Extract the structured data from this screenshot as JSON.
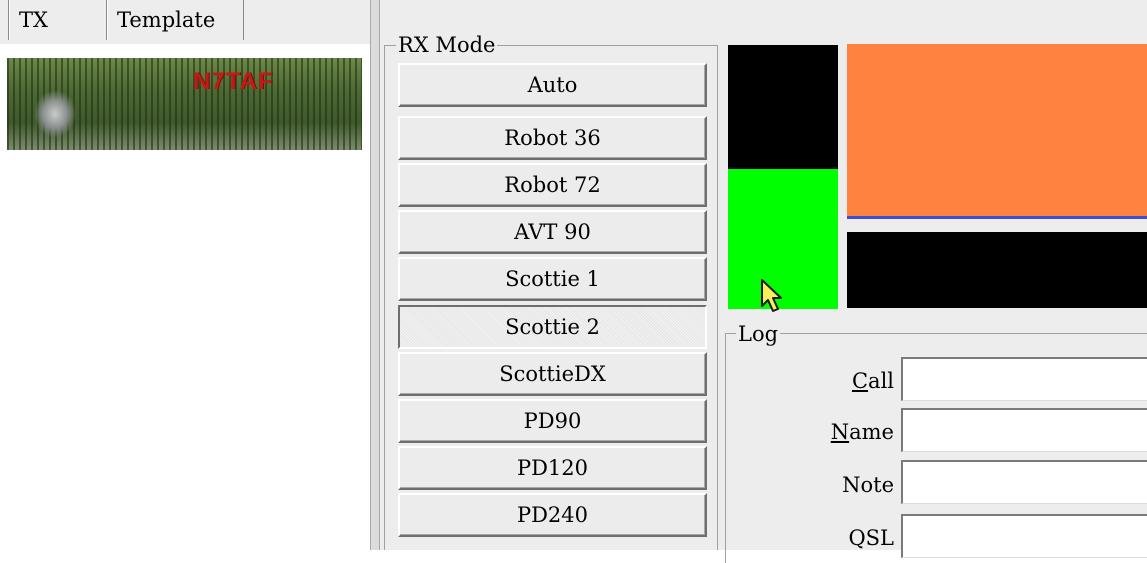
{
  "tabs": [
    {
      "label": "TX"
    },
    {
      "label": "Template"
    }
  ],
  "preview": {
    "callsign": "N7TAF"
  },
  "rx_mode": {
    "title": "RX Mode",
    "buttons": [
      {
        "label": "Auto",
        "selected": false
      },
      {
        "label": "Robot 36",
        "selected": false
      },
      {
        "label": "Robot 72",
        "selected": false
      },
      {
        "label": "AVT 90",
        "selected": false
      },
      {
        "label": "Scottie 1",
        "selected": false
      },
      {
        "label": "Scottie 2",
        "selected": true
      },
      {
        "label": "ScottieDX",
        "selected": false
      },
      {
        "label": "PD90",
        "selected": false
      },
      {
        "label": "PD120",
        "selected": false
      },
      {
        "label": "PD240",
        "selected": false
      }
    ]
  },
  "colors": {
    "orange_panel": "#ff8340",
    "green_panel": "#00ff00",
    "black_panel": "#000000",
    "window_bg": "#ededed"
  },
  "log": {
    "title": "Log",
    "fields": [
      {
        "label": "Call",
        "mnemonic": "C",
        "rest": "all",
        "value": ""
      },
      {
        "label": "Name",
        "mnemonic": "N",
        "rest": "ame",
        "value": ""
      },
      {
        "label": "Note",
        "mnemonic": "",
        "rest": "Note",
        "value": ""
      },
      {
        "label": "QSL",
        "mnemonic": "",
        "rest": "QSL",
        "value": ""
      }
    ]
  },
  "cursor": {
    "icon": "arrow-pointer-icon"
  }
}
